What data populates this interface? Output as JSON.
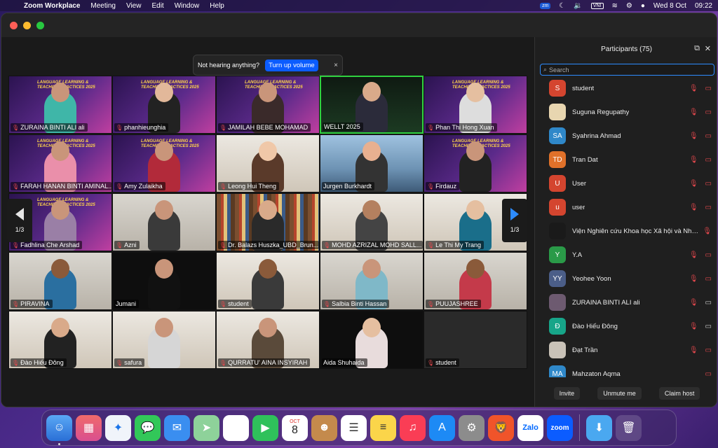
{
  "menubar": {
    "app": "Zoom Workplace",
    "items": [
      "Meeting",
      "View",
      "Edit",
      "Window",
      "Help"
    ],
    "date": "Wed 8 Oct",
    "time": "09:22",
    "zm": "zm",
    "vni": "VNI"
  },
  "notice": {
    "text": "Not hearing anything?",
    "button": "Turn up volume",
    "close": "×"
  },
  "pager": {
    "left": "1/3",
    "right": "1/3"
  },
  "tiles": [
    {
      "name": "ZURAINA BINTI ALI ali",
      "muted": true
    },
    {
      "name": "phanhieunghia",
      "muted": true
    },
    {
      "name": "JAMILAH BEBE MOHAMAD",
      "muted": true
    },
    {
      "name": "WELLT 2025",
      "muted": false
    },
    {
      "name": "Phan Thi Hong Xuan",
      "muted": true
    },
    {
      "name": "FARAH HANAN BINTI AMINAL...",
      "muted": true
    },
    {
      "name": "Amy Zulaikha",
      "muted": true
    },
    {
      "name": "Leong Hui Theng",
      "muted": true
    },
    {
      "name": "Jurgen Burkhardt",
      "muted": false
    },
    {
      "name": "Firdauz",
      "muted": true
    },
    {
      "name": "Fadhlina Che Arshad",
      "muted": true
    },
    {
      "name": "Azni",
      "muted": true
    },
    {
      "name": "Dr. Balazs Huszka_UBD_Brun...",
      "muted": true
    },
    {
      "name": "MOHD AZRIZAL MOHD SALL...",
      "muted": true
    },
    {
      "name": "Le Thi My Trang",
      "muted": true
    },
    {
      "name": "PIRAVINA",
      "muted": true
    },
    {
      "name": "Jumani",
      "muted": false
    },
    {
      "name": "student",
      "muted": true
    },
    {
      "name": "Salbia Binti Hassan",
      "muted": true
    },
    {
      "name": "PUUJASHREE",
      "muted": true
    },
    {
      "name": "Đào Hiếu Đông",
      "muted": true
    },
    {
      "name": "safura",
      "muted": true
    },
    {
      "name": "QURRATU' AINA INSYIRAH",
      "muted": true
    },
    {
      "name": "Aida Shuhaida",
      "muted": false
    },
    {
      "name": "student",
      "muted": true
    }
  ],
  "banner_text": "LANGUAGE LEARNING & TEACHING PRACTICES 2025",
  "panel": {
    "title": "Participants (75)",
    "search_placeholder": "Search",
    "participants": [
      {
        "name": "student",
        "initials": "S",
        "color": "#d4452f",
        "cam": "off"
      },
      {
        "name": "Suguna Regupathy",
        "initials": "",
        "color": "#e8d6b0",
        "cam": "off"
      },
      {
        "name": "Syahrina Ahmad",
        "initials": "SA",
        "color": "#2f88c9",
        "cam": "off"
      },
      {
        "name": "Tran Dat",
        "initials": "TD",
        "color": "#e0712a",
        "cam": "off"
      },
      {
        "name": "User",
        "initials": "U",
        "color": "#d4452f",
        "cam": "off"
      },
      {
        "name": "user",
        "initials": "u",
        "color": "#d4452f",
        "cam": "off"
      },
      {
        "name": "Viện Nghiên cứu Khoa học Xã hội và Nhân...",
        "initials": "",
        "color": "#1a1a1a",
        "cam": "none"
      },
      {
        "name": "Y.A",
        "initials": "Y",
        "color": "#2a9a48",
        "cam": "off"
      },
      {
        "name": "Yeohee Yoon",
        "initials": "YY",
        "color": "#4b5e88",
        "cam": "off"
      },
      {
        "name": "ZURAINA BINTI ALI ali",
        "initials": "",
        "color": "#6d5a70",
        "cam": "on"
      },
      {
        "name": "Đào Hiếu Đông",
        "initials": "Đ",
        "color": "#17a589",
        "cam": "on"
      },
      {
        "name": "Đạt Trần",
        "initials": "",
        "color": "#c9c2b8",
        "cam": "off"
      },
      {
        "name": "Mahzaton Aqma",
        "initials": "MA",
        "color": "#2f88c9",
        "cam": "none2"
      }
    ],
    "buttons": [
      "Invite",
      "Unmute me",
      "Claim host"
    ]
  },
  "dock": {
    "calendar_month": "OCT",
    "calendar_day": "8",
    "zalo": "Zalo",
    "zoom": "zoom"
  }
}
